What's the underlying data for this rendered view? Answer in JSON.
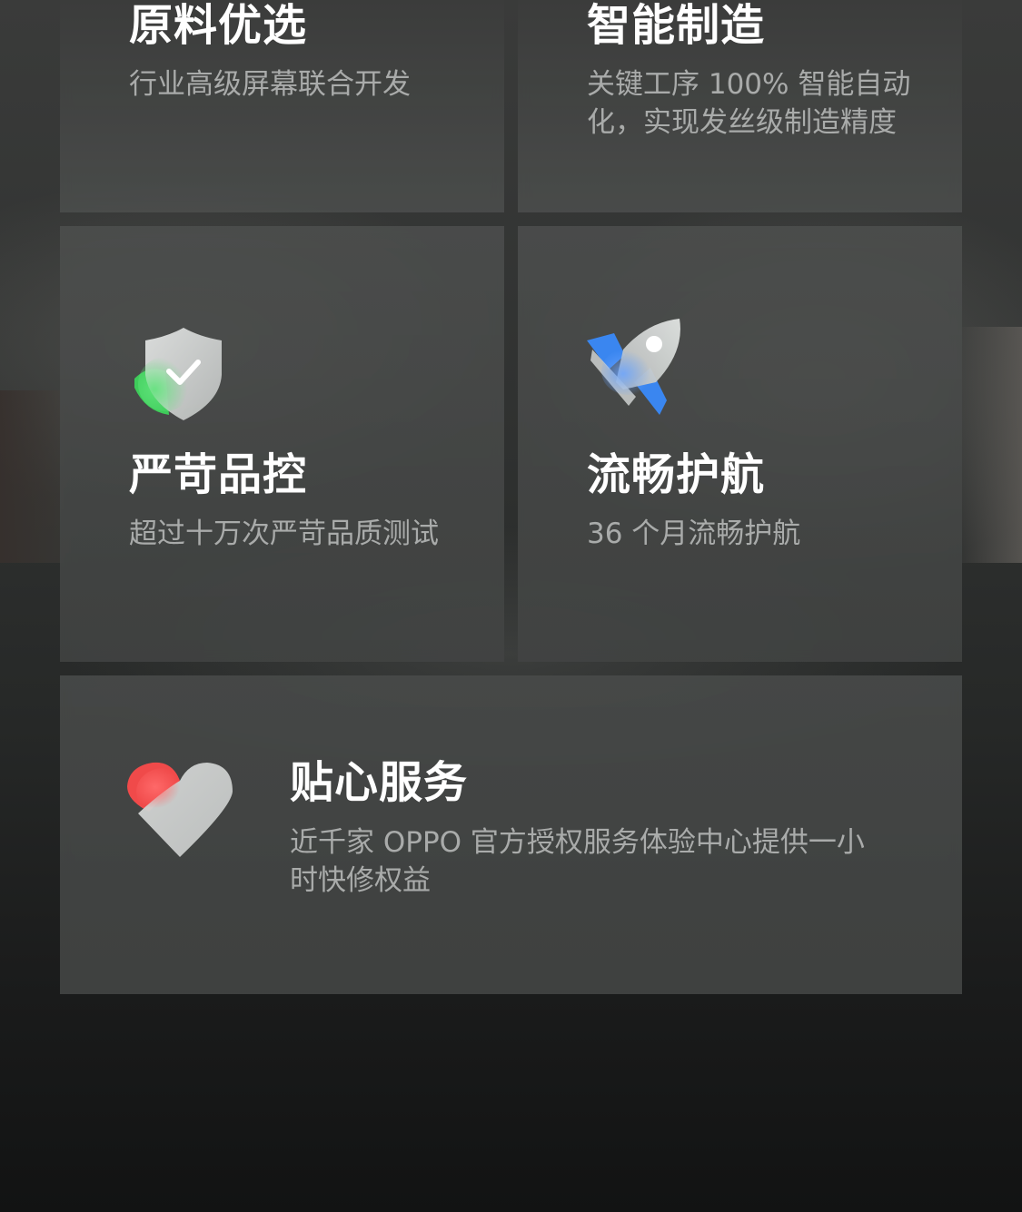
{
  "features": [
    {
      "title": "原料优选",
      "description": "行业高级屏幕联合开发"
    },
    {
      "title": "智能制造",
      "description": "关键工序 100% 智能自动化，实现发丝级制造精度"
    },
    {
      "title": "严苛品控",
      "description": "超过十万次严苛品质测试",
      "icon": "shield-check-icon"
    },
    {
      "title": "流畅护航",
      "description": "36 个月流畅护航",
      "icon": "rocket-icon"
    },
    {
      "title": "贴心服务",
      "description": "近千家 OPPO 官方授权服务体验中心提供一小时快修权益",
      "icon": "heart-icon"
    }
  ],
  "colors": {
    "title": "#ffffff",
    "description": "#a9abaa",
    "shield_accent": "#3ecb5a",
    "rocket_accent": "#3a86f0",
    "heart_accent": "#f04a4a"
  }
}
